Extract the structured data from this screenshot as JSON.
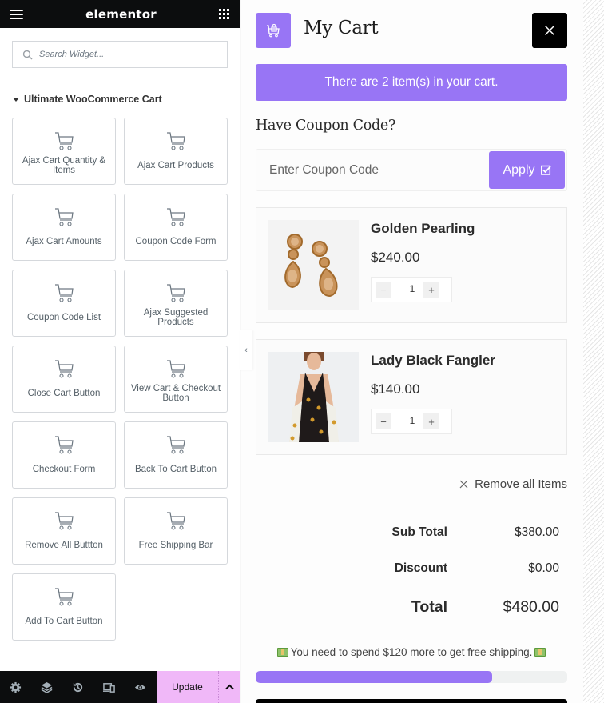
{
  "editor": {
    "brand": "elementor",
    "search": {
      "placeholder": "Search Widget...",
      "value": ""
    },
    "category": "Ultimate WooCommerce Cart",
    "widgets": [
      {
        "label": "Ajax Cart Quantity & Items",
        "icon": "cart-icon"
      },
      {
        "label": "Ajax Cart Products",
        "icon": "cart-icon"
      },
      {
        "label": "Ajax Cart Amounts",
        "icon": "cart-icon"
      },
      {
        "label": "Coupon Code Form",
        "icon": "cart-icon"
      },
      {
        "label": "Coupon Code List",
        "icon": "cart-icon"
      },
      {
        "label": "Ajax Suggested Products",
        "icon": "cart-icon"
      },
      {
        "label": "Close Cart Button",
        "icon": "cart-icon"
      },
      {
        "label": "View Cart & Checkout Button",
        "icon": "cart-icon"
      },
      {
        "label": "Checkout Form",
        "icon": "cart-icon"
      },
      {
        "label": "Back To Cart Button",
        "icon": "cart-icon"
      },
      {
        "label": "Remove All Buttton",
        "icon": "cart-icon"
      },
      {
        "label": "Free Shipping Bar",
        "icon": "cart-icon"
      },
      {
        "label": "Add To Cart Button",
        "icon": "cart-icon"
      }
    ],
    "footer": {
      "icons": [
        "gear-icon",
        "layers-icon",
        "history-icon",
        "responsive-icon",
        "eye-icon"
      ],
      "update_label": "Update"
    }
  },
  "cart": {
    "title": "My Cart",
    "count_message": "There are 2 item(s) in your cart.",
    "coupon": {
      "heading": "Have Coupon Code?",
      "placeholder": "Enter Coupon Code",
      "value": "",
      "apply_label": "Apply"
    },
    "items": [
      {
        "name": "Golden Pearling",
        "price": "$240.00",
        "quantity": "1"
      },
      {
        "name": "Lady Black Fangler",
        "price": "$140.00",
        "quantity": "1"
      }
    ],
    "remove_all_label": "Remove all Items",
    "totals": {
      "subtotal_label": "Sub Total",
      "subtotal": "$380.00",
      "discount_label": "Discount",
      "discount": "$0.00",
      "total_label": "Total",
      "total": "$480.00"
    },
    "free_shipping": {
      "message": "You need to spend $120 more to get free shipping.",
      "progress_percent": 76
    }
  },
  "colors": {
    "accent": "#9875f5",
    "update_button": "#f0b8f8",
    "dark": "#0c0d0e"
  }
}
